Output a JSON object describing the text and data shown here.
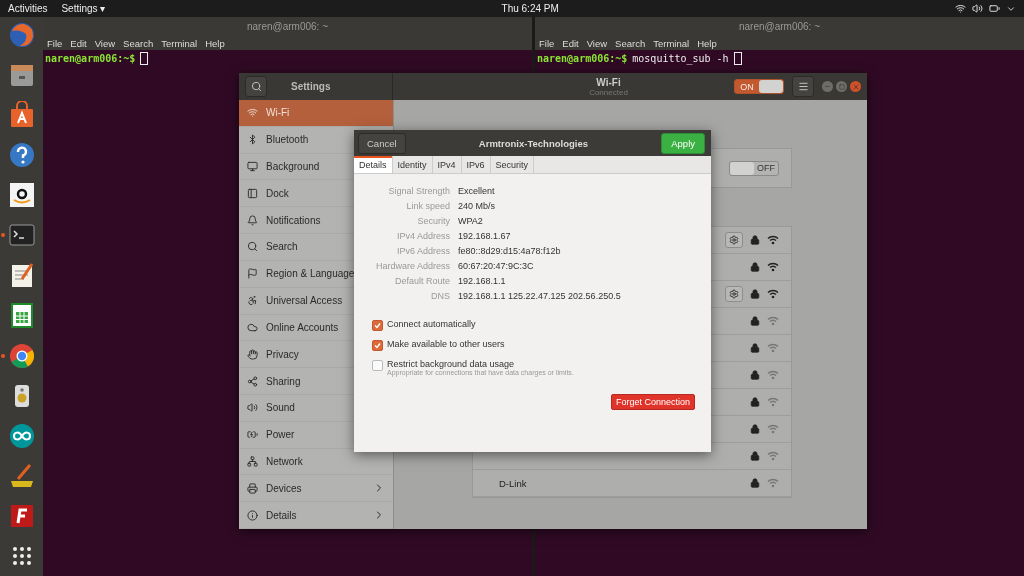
{
  "top_bar": {
    "activities": "Activities",
    "app_menu": "Settings ▾",
    "clock": "Thu  6:24 PM"
  },
  "dock": [
    {
      "kind": "browser",
      "running": false
    },
    {
      "kind": "files",
      "running": false
    },
    {
      "kind": "store",
      "running": false
    },
    {
      "kind": "help",
      "running": false
    },
    {
      "kind": "shop",
      "running": false
    },
    {
      "kind": "terminal",
      "running": true
    },
    {
      "kind": "notes",
      "running": false
    },
    {
      "kind": "sheet",
      "running": false
    },
    {
      "kind": "chrome",
      "running": true
    },
    {
      "kind": "speaker",
      "running": false
    },
    {
      "kind": "infinity",
      "running": false
    },
    {
      "kind": "pencil",
      "running": false
    },
    {
      "kind": "ftp",
      "running": false
    },
    {
      "kind": "apps",
      "running": false
    }
  ],
  "terminals": [
    {
      "title": "naren@arm006: ~",
      "menu": [
        "File",
        "Edit",
        "View",
        "Search",
        "Terminal",
        "Help"
      ],
      "prompt": "naren@arm006:~$"
    },
    {
      "title": "naren@arm006: ~",
      "menu": [
        "File",
        "Edit",
        "View",
        "Search",
        "Terminal",
        "Help"
      ],
      "prompt": "naren@arm006:~$",
      "command": "mosquitto_sub -h"
    }
  ],
  "settings": {
    "title": "Settings",
    "panel_title": "Wi-Fi",
    "panel_subtitle": "Connected",
    "wifi_switch": {
      "label": "ON",
      "on": true
    },
    "sidebar": [
      {
        "label": "Wi-Fi",
        "kind": "wifi",
        "selected": true,
        "chevron": false
      },
      {
        "label": "Bluetooth",
        "kind": "bluetooth",
        "selected": false,
        "chevron": false
      },
      {
        "label": "Background",
        "kind": "background",
        "selected": false,
        "chevron": false
      },
      {
        "label": "Dock",
        "kind": "dock",
        "selected": false,
        "chevron": false
      },
      {
        "label": "Notifications",
        "kind": "bell",
        "selected": false,
        "chevron": false
      },
      {
        "label": "Search",
        "kind": "search",
        "selected": false,
        "chevron": false
      },
      {
        "label": "Region & Language",
        "kind": "flag",
        "selected": false,
        "chevron": false
      },
      {
        "label": "Universal Access",
        "kind": "access",
        "selected": false,
        "chevron": false
      },
      {
        "label": "Online Accounts",
        "kind": "accounts",
        "selected": false,
        "chevron": false
      },
      {
        "label": "Privacy",
        "kind": "hand",
        "selected": false,
        "chevron": false
      },
      {
        "label": "Sharing",
        "kind": "share",
        "selected": false,
        "chevron": false
      },
      {
        "label": "Sound",
        "kind": "sound",
        "selected": false,
        "chevron": false
      },
      {
        "label": "Power",
        "kind": "power",
        "selected": false,
        "chevron": false
      },
      {
        "label": "Network",
        "kind": "network",
        "selected": false,
        "chevron": false
      },
      {
        "label": "Devices",
        "kind": "devices",
        "selected": false,
        "chevron": true
      },
      {
        "label": "Details",
        "kind": "info",
        "selected": false,
        "chevron": true
      }
    ],
    "airplane_switch": {
      "label": "OFF",
      "on": false
    },
    "networks": [
      {
        "gear": true,
        "kind": "strong"
      },
      {
        "gear": false,
        "kind": "strong"
      },
      {
        "gear": true,
        "kind": "strong"
      },
      {
        "gear": false,
        "kind": "weak"
      },
      {
        "gear": false,
        "kind": "weak"
      },
      {
        "gear": false,
        "kind": "weak"
      },
      {
        "gear": false,
        "kind": "weak"
      },
      {
        "gear": false,
        "kind": "weak"
      },
      {
        "gear": false,
        "kind": "weak"
      },
      {
        "name": "D-Link",
        "gear": false,
        "kind": "weak"
      }
    ]
  },
  "dialog": {
    "cancel": "Cancel",
    "title": "Armtronix-Technologies",
    "apply": "Apply",
    "tabs": [
      {
        "label": "Details",
        "selected": true
      },
      {
        "label": "Identity",
        "selected": false
      },
      {
        "label": "IPv4",
        "selected": false
      },
      {
        "label": "IPv6",
        "selected": false
      },
      {
        "label": "Security",
        "selected": false
      }
    ],
    "details": [
      {
        "label": "Signal Strength",
        "value": "Excellent"
      },
      {
        "label": "Link speed",
        "value": "240 Mb/s"
      },
      {
        "label": "Security",
        "value": "WPA2"
      },
      {
        "label": "IPv4 Address",
        "value": "192.168.1.67"
      },
      {
        "label": "IPv6 Address",
        "value": "fe80::8d29:d15:4a78:f12b"
      },
      {
        "label": "Hardware Address",
        "value": "60:67:20:47:9C:3C"
      },
      {
        "label": "Default Route",
        "value": "192.168.1.1"
      },
      {
        "label": "DNS",
        "value": "192.168.1.1 125.22.47.125 202.56.250.5"
      }
    ],
    "options": [
      {
        "label": "Connect automatically",
        "checked": true
      },
      {
        "label": "Make available to other users",
        "checked": true
      },
      {
        "label": "Restrict background data usage",
        "checked": false,
        "hint": "Appropriate for connections that have data charges or limits."
      }
    ],
    "forget": "Forget Connection"
  }
}
